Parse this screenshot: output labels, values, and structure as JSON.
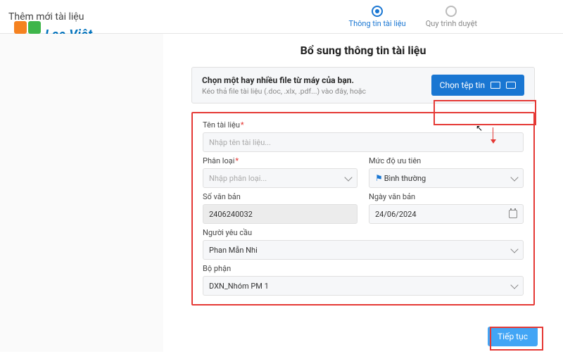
{
  "page_title": "Thêm mới tài liệu",
  "logo_text": "Lạc Việt",
  "stepper": {
    "step1": "Thông tin tài liệu",
    "step2": "Quy trình duyệt"
  },
  "content_title": "Bổ sung thông tin tài liệu",
  "upload": {
    "main": "Chọn một hay nhiều file từ máy của bạn.",
    "sub": "Kéo thả file tài liệu (.doc, .xlx, .pdf...) vào đây, hoặc",
    "button": "Chọn tệp tin"
  },
  "form": {
    "doc_name_label": "Tên tài liệu",
    "doc_name_placeholder": "Nhập tên tài liệu...",
    "classify_label": "Phân loại",
    "classify_placeholder": "Nhập phân loại...",
    "priority_label": "Mức độ ưu tiên",
    "priority_value": "Bình thường",
    "doc_number_label": "Số văn bản",
    "doc_number_value": "2406240032",
    "doc_date_label": "Ngày văn bản",
    "doc_date_value": "24/06/2024",
    "requester_label": "Người yêu cầu",
    "requester_value": "Phan Mẫn Nhi",
    "dept_label": "Bộ phận",
    "dept_value": "DXN_Nhóm PM 1"
  },
  "next_button": "Tiếp tục"
}
